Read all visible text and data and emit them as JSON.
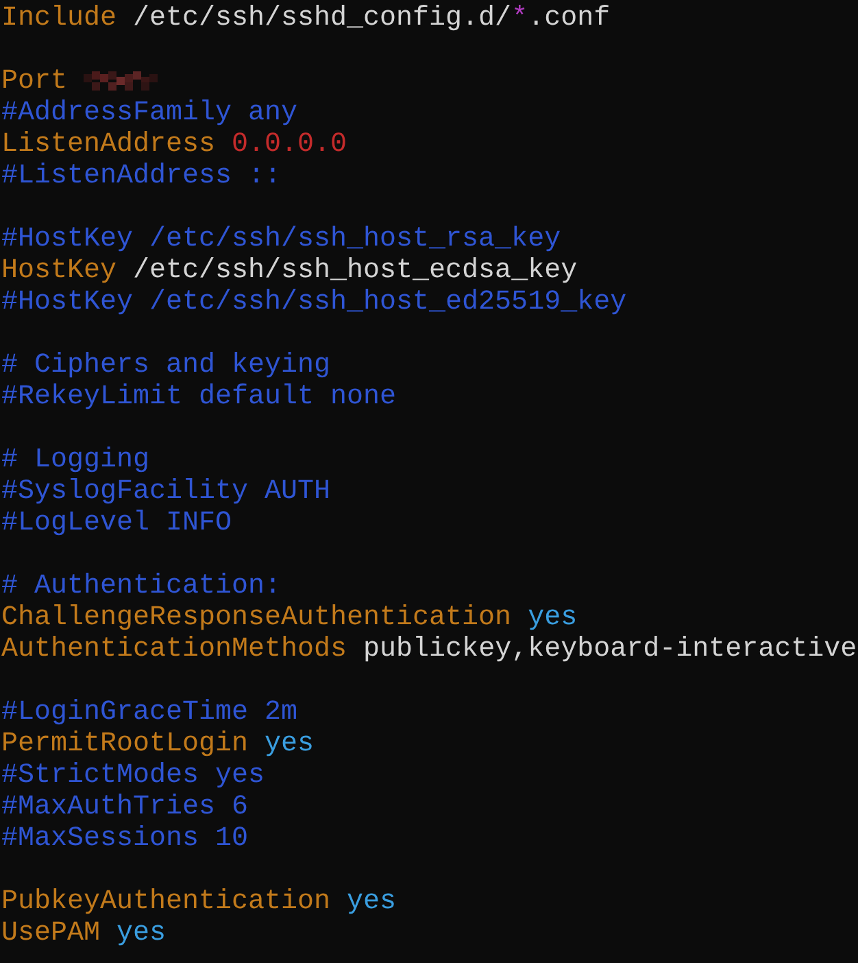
{
  "lines": [
    {
      "kind": "code",
      "tokens": [
        {
          "kind": "keyword",
          "text": "Include"
        },
        {
          "kind": "plain",
          "text": " /etc/ssh/sshd_config.d/"
        },
        {
          "kind": "glob",
          "text": "*"
        },
        {
          "kind": "plain",
          "text": ".conf"
        }
      ]
    },
    {
      "kind": "blank"
    },
    {
      "kind": "code",
      "tokens": [
        {
          "kind": "keyword",
          "text": "Port "
        },
        {
          "kind": "redacted"
        }
      ]
    },
    {
      "kind": "code",
      "tokens": [
        {
          "kind": "comment",
          "text": "#AddressFamily any"
        }
      ]
    },
    {
      "kind": "code",
      "tokens": [
        {
          "kind": "keyword",
          "text": "ListenAddress "
        },
        {
          "kind": "address",
          "text": "0.0.0.0"
        }
      ]
    },
    {
      "kind": "code",
      "tokens": [
        {
          "kind": "comment",
          "text": "#ListenAddress ::"
        }
      ]
    },
    {
      "kind": "blank"
    },
    {
      "kind": "code",
      "tokens": [
        {
          "kind": "comment",
          "text": "#HostKey /etc/ssh/ssh_host_rsa_key"
        }
      ]
    },
    {
      "kind": "code",
      "tokens": [
        {
          "kind": "keyword",
          "text": "HostKey"
        },
        {
          "kind": "plain",
          "text": " /etc/ssh/ssh_host_ecdsa_key"
        }
      ]
    },
    {
      "kind": "code",
      "tokens": [
        {
          "kind": "comment",
          "text": "#HostKey /etc/ssh/ssh_host_ed25519_key"
        }
      ]
    },
    {
      "kind": "blank"
    },
    {
      "kind": "code",
      "tokens": [
        {
          "kind": "comment",
          "text": "# Ciphers and keying"
        }
      ]
    },
    {
      "kind": "code",
      "tokens": [
        {
          "kind": "comment",
          "text": "#RekeyLimit default none"
        }
      ]
    },
    {
      "kind": "blank"
    },
    {
      "kind": "code",
      "tokens": [
        {
          "kind": "comment",
          "text": "# Logging"
        }
      ]
    },
    {
      "kind": "code",
      "tokens": [
        {
          "kind": "comment",
          "text": "#SyslogFacility AUTH"
        }
      ]
    },
    {
      "kind": "code",
      "tokens": [
        {
          "kind": "comment",
          "text": "#LogLevel INFO"
        }
      ]
    },
    {
      "kind": "blank"
    },
    {
      "kind": "code",
      "tokens": [
        {
          "kind": "comment",
          "text": "# Authentication:"
        }
      ]
    },
    {
      "kind": "code",
      "tokens": [
        {
          "kind": "keyword",
          "text": "ChallengeResponseAuthentication "
        },
        {
          "kind": "value",
          "text": "yes"
        }
      ]
    },
    {
      "kind": "code",
      "tokens": [
        {
          "kind": "keyword",
          "text": "AuthenticationMethods"
        },
        {
          "kind": "plain",
          "text": " publickey,keyboard-interactive"
        }
      ]
    },
    {
      "kind": "blank"
    },
    {
      "kind": "code",
      "tokens": [
        {
          "kind": "comment",
          "text": "#LoginGraceTime 2m"
        }
      ]
    },
    {
      "kind": "code",
      "tokens": [
        {
          "kind": "keyword",
          "text": "PermitRootLogin "
        },
        {
          "kind": "value",
          "text": "yes"
        }
      ]
    },
    {
      "kind": "code",
      "tokens": [
        {
          "kind": "comment",
          "text": "#StrictModes yes"
        }
      ]
    },
    {
      "kind": "code",
      "tokens": [
        {
          "kind": "comment",
          "text": "#MaxAuthTries 6"
        }
      ]
    },
    {
      "kind": "code",
      "tokens": [
        {
          "kind": "comment",
          "text": "#MaxSessions 10"
        }
      ]
    },
    {
      "kind": "blank"
    },
    {
      "kind": "code",
      "tokens": [
        {
          "kind": "keyword",
          "text": "PubkeyAuthentication "
        },
        {
          "kind": "value",
          "text": "yes"
        }
      ]
    },
    {
      "kind": "code",
      "tokens": [
        {
          "kind": "keyword",
          "text": "UsePAM "
        },
        {
          "kind": "value",
          "text": "yes"
        }
      ]
    }
  ]
}
